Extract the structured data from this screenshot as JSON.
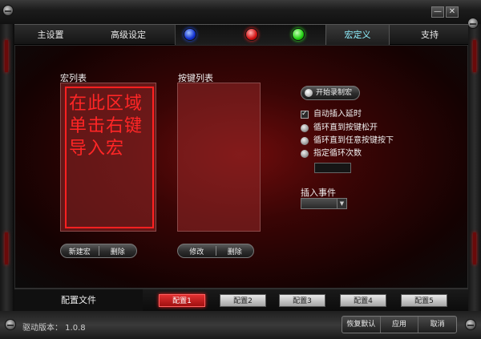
{
  "window": {
    "minimize_glyph": "—",
    "close_glyph": "✕"
  },
  "nav": {
    "tabs": [
      {
        "label": "主设置"
      },
      {
        "label": "高级设定"
      },
      {
        "label": "宏定义"
      },
      {
        "label": "支持"
      }
    ],
    "active_tab": "宏定义",
    "leds": [
      "blue",
      "red",
      "green"
    ]
  },
  "macro": {
    "macro_list_label": "宏列表",
    "macro_list_hint": "在此区域单击右键导入宏",
    "key_list_label": "按键列表",
    "new_macro": "新建宏",
    "delete_macro": "删除",
    "modify_key": "修改",
    "delete_key": "删除",
    "record_button": "开始录制宏",
    "options": [
      {
        "label": "自动插入延时",
        "type": "checkbox",
        "checked": true
      },
      {
        "label": "循环直到按键松开",
        "type": "radio"
      },
      {
        "label": "循环直到任意按键按下",
        "type": "radio"
      },
      {
        "label": "指定循环次数",
        "type": "radio"
      }
    ],
    "insert_event_label": "插入事件"
  },
  "profiles": {
    "title": "配置文件",
    "tabs": [
      "配置1",
      "配置2",
      "配置3",
      "配置4",
      "配置5"
    ],
    "active": "配置1"
  },
  "footer": {
    "version": "驱动版本： 1.0.8",
    "buttons": [
      "恢复默认",
      "应用",
      "取消"
    ]
  },
  "colors": {
    "accent_red": "#d01010",
    "active_tab_text": "#8ff0ff"
  }
}
